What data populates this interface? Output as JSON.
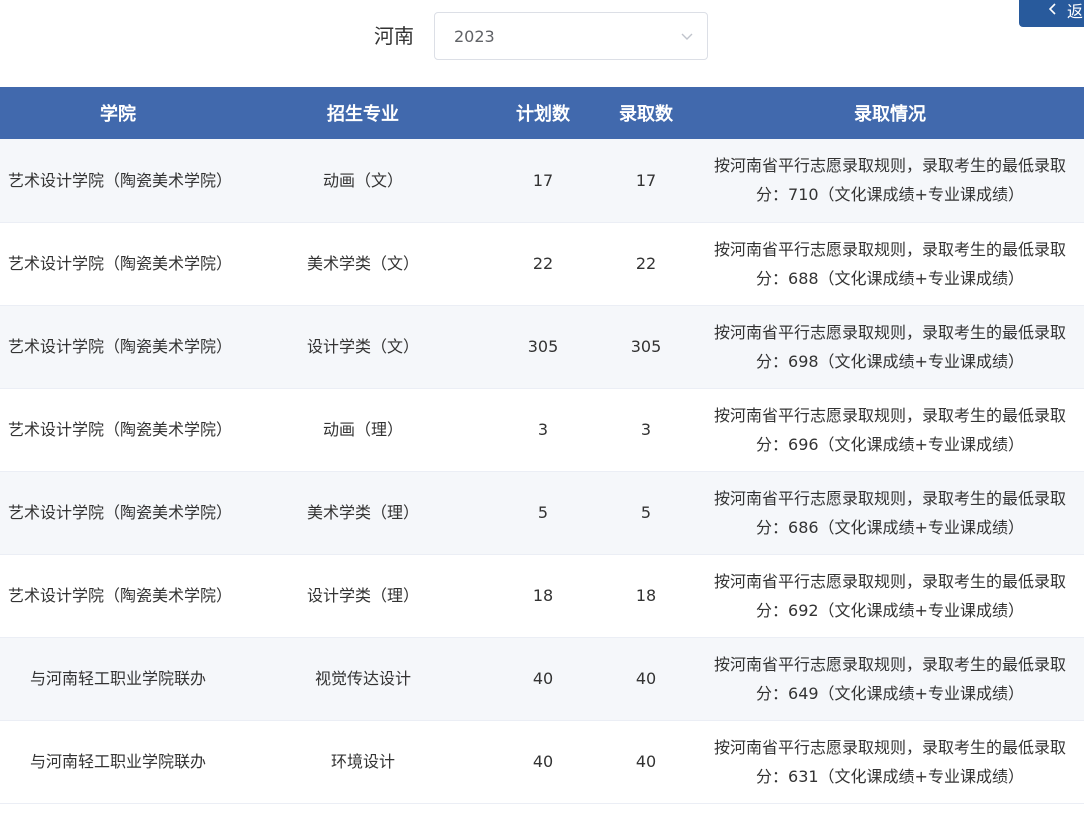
{
  "filter": {
    "province_label": "河南",
    "year_value": "2023"
  },
  "back_button": {
    "label": "返"
  },
  "table": {
    "headers": [
      "学院",
      "招生专业",
      "计划数",
      "录取数",
      "录取情况"
    ],
    "rows": [
      {
        "college": "艺术设计学院（陶瓷美术学院）",
        "major": "动画（文）",
        "plan": "17",
        "admitted": "17",
        "status": "按河南省平行志愿录取规则，录取考生的最低录取分：710（文化课成绩+专业课成绩）"
      },
      {
        "college": "艺术设计学院（陶瓷美术学院）",
        "major": "美术学类（文）",
        "plan": "22",
        "admitted": "22",
        "status": "按河南省平行志愿录取规则，录取考生的最低录取分：688（文化课成绩+专业课成绩）"
      },
      {
        "college": "艺术设计学院（陶瓷美术学院）",
        "major": "设计学类（文）",
        "plan": "305",
        "admitted": "305",
        "status": "按河南省平行志愿录取规则，录取考生的最低录取分：698（文化课成绩+专业课成绩）"
      },
      {
        "college": "艺术设计学院（陶瓷美术学院）",
        "major": "动画（理）",
        "plan": "3",
        "admitted": "3",
        "status": "按河南省平行志愿录取规则，录取考生的最低录取分：696（文化课成绩+专业课成绩）"
      },
      {
        "college": "艺术设计学院（陶瓷美术学院）",
        "major": "美术学类（理）",
        "plan": "5",
        "admitted": "5",
        "status": "按河南省平行志愿录取规则，录取考生的最低录取分：686（文化课成绩+专业课成绩）"
      },
      {
        "college": "艺术设计学院（陶瓷美术学院）",
        "major": "设计学类（理）",
        "plan": "18",
        "admitted": "18",
        "status": "按河南省平行志愿录取规则，录取考生的最低录取分：692（文化课成绩+专业课成绩）"
      },
      {
        "college": "与河南轻工职业学院联办",
        "major": "视觉传达设计",
        "plan": "40",
        "admitted": "40",
        "status": "按河南省平行志愿录取规则，录取考生的最低录取分：649（文化课成绩+专业课成绩）"
      },
      {
        "college": "与河南轻工职业学院联办",
        "major": "环境设计",
        "plan": "40",
        "admitted": "40",
        "status": "按河南省平行志愿录取规则，录取考生的最低录取分：631（文化课成绩+专业课成绩）"
      }
    ]
  },
  "colors": {
    "header_bg": "#4169ad",
    "button_bg": "#285a9c",
    "stripe_bg": "#f5f7fa"
  },
  "icons": {
    "select_arrow": "chevron-down-icon",
    "back_arrow": "chevron-left-icon"
  }
}
